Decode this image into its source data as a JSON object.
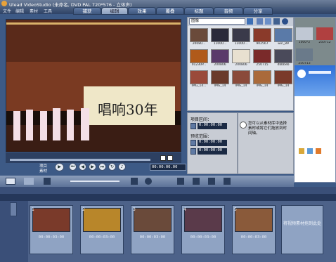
{
  "window": {
    "title": "Ulead VideoStudio (未命名, DVD PAL 720*576 - 立体声)"
  },
  "menu": [
    "文件",
    "编辑",
    "素材",
    "工具"
  ],
  "steps": [
    {
      "label": "捕获",
      "active": false
    },
    {
      "label": "编辑",
      "active": true
    },
    {
      "label": "效果",
      "active": false
    },
    {
      "label": "覆叠",
      "active": false
    },
    {
      "label": "标题",
      "active": false
    },
    {
      "label": "音频",
      "active": false
    },
    {
      "label": "分享",
      "active": false
    }
  ],
  "preview": {
    "banner_text": "唱响30年"
  },
  "player": {
    "project_label": "项目",
    "clip_label": "素材",
    "timecode": "00:00:00.00"
  },
  "library": {
    "category": "图像",
    "thumbnails": [
      {
        "caption": "20080..."
      },
      {
        "caption": "11000..."
      },
      {
        "caption": "11000..."
      },
      {
        "caption": "902567"
      },
      {
        "caption": "win_89"
      },
      {
        "caption": "1000*2"
      },
      {
        "caption": "250712"
      },
      {
        "caption": "01230P..."
      },
      {
        "caption": "200806"
      },
      {
        "caption": "200806"
      },
      {
        "caption": "250715"
      },
      {
        "caption": "dbbbeb"
      },
      {
        "caption": "250713"
      },
      {
        "caption": "IMG_14..."
      },
      {
        "caption": "IMG_14"
      },
      {
        "caption": "IMG_14"
      },
      {
        "caption": "IMG_14"
      },
      {
        "caption": "IMG_14"
      }
    ]
  },
  "options": {
    "duration_label": "项目区间：",
    "duration": "0:00:00:00",
    "range_label": "预览范围：",
    "range_start": "0:00:00:00",
    "range_end": "0:00:00:00"
  },
  "info": {
    "hint": "您可以从素材库中选择素材或将它们拖放到时间轴。"
  },
  "timeline": {
    "clips": [
      {
        "index": "1",
        "timecode": "00:00:03:00"
      },
      {
        "index": "2",
        "timecode": "00:00:03:00"
      },
      {
        "index": "3",
        "timecode": "00:00:03:00"
      },
      {
        "index": "4",
        "timecode": "00:00:03:00"
      },
      {
        "index": "5",
        "timecode": "00:00:03:00"
      }
    ],
    "drop_hint": "将视频素材拖到此处"
  }
}
